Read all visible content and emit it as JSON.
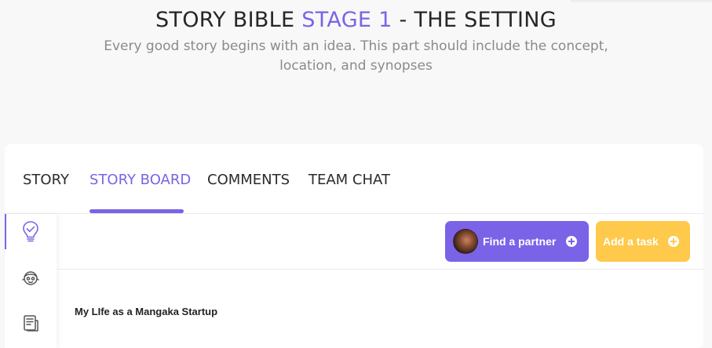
{
  "header": {
    "title_prefix": "STORY BIBLE ",
    "title_accent": "STAGE 1",
    "title_suffix": " - THE SETTING",
    "subtitle": "Every good story begins with an idea. This part should include the concept, location, and synopses",
    "accent_color": "#7c63e6"
  },
  "tabs": [
    {
      "label": "STORY",
      "active": false
    },
    {
      "label": "STORY BOARD",
      "active": true
    },
    {
      "label": "COMMENTS",
      "active": false
    },
    {
      "label": "TEAM CHAT",
      "active": false
    }
  ],
  "sidebar": {
    "items": [
      {
        "icon": "lightbulb-check-icon",
        "active": true
      },
      {
        "icon": "character-face-icon",
        "active": false
      },
      {
        "icon": "document-list-icon",
        "active": false
      }
    ]
  },
  "toolbar": {
    "find_partner_label": "Find a partner",
    "add_task_label": "Add a task",
    "find_partner_color": "#7b63e7",
    "add_task_color": "#ffc94b"
  },
  "story": {
    "title": "My LIfe as a Mangaka Startup"
  }
}
